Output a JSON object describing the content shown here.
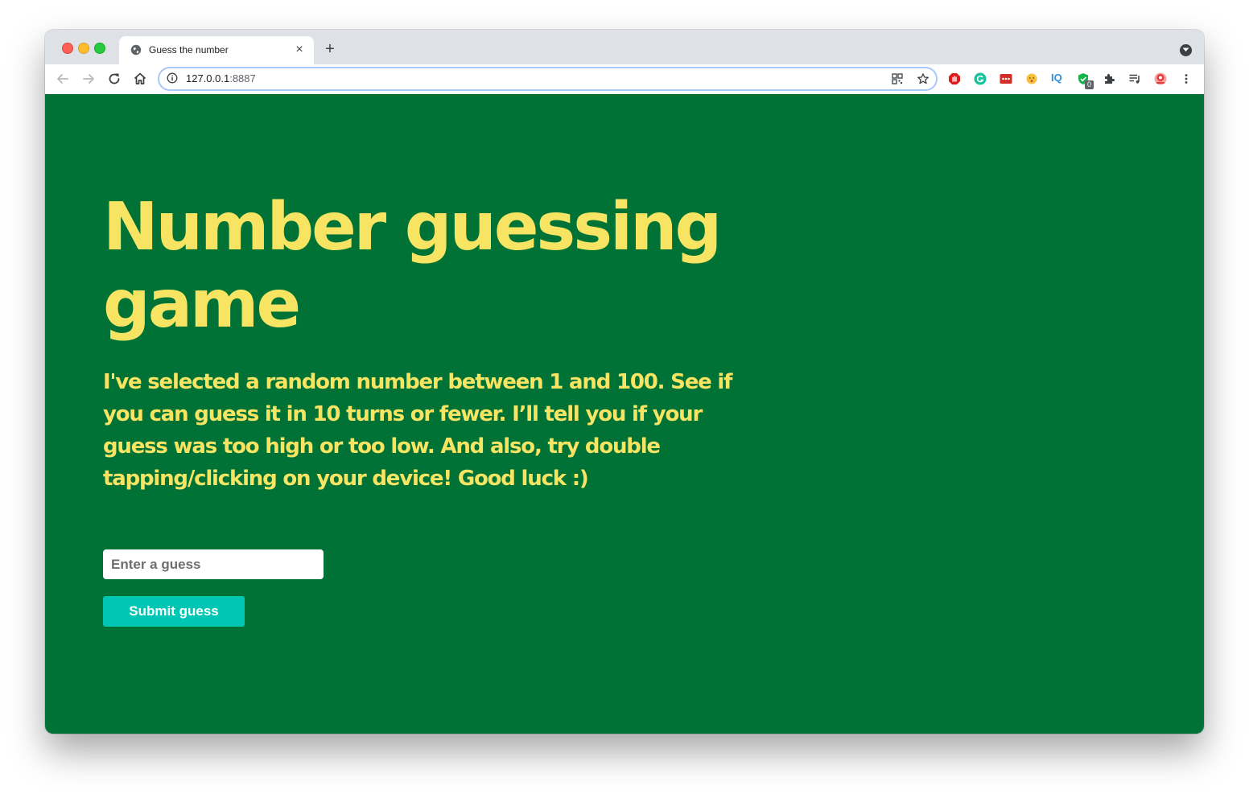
{
  "browser": {
    "tab_title": "Guess the number",
    "close_symbol": "×",
    "new_tab_symbol": "+",
    "url_host": "127.0.0.1",
    "url_port": ":8887",
    "extension_badge": "0",
    "extension_iq": "IQ"
  },
  "game": {
    "title": "Number guessing game",
    "intro": "I've selected a random number between 1 and 100. See if you can guess it in 10 turns or fewer. I’ll tell you if your guess was too high or too low. And also, try double tapping/clicking on your device! Good luck :)",
    "input_placeholder": "Enter a guess",
    "input_value": "",
    "submit_label": "Submit guess"
  },
  "colors": {
    "background": "#007236",
    "text": "#f7e463",
    "button": "#00c7b4"
  }
}
